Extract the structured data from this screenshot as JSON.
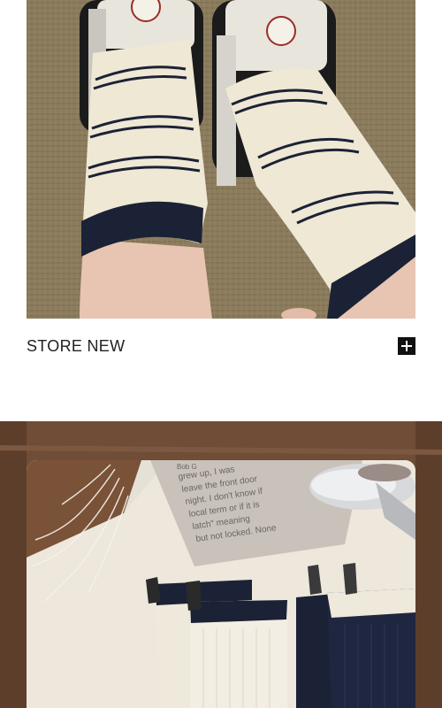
{
  "section": {
    "caption": "STORE NEW"
  },
  "book_text": {
    "lines": [
      "Bob G",
      "grew up, I was",
      "leave the front door",
      "night. I don't know if",
      "local term or if it is",
      "latch\" meaning",
      "but not locked. None"
    ]
  },
  "colors": {
    "navy": "#1c2235",
    "cream": "#f1ecdf",
    "carpet": "#8b7b5d",
    "wood": "#6b4a33"
  }
}
